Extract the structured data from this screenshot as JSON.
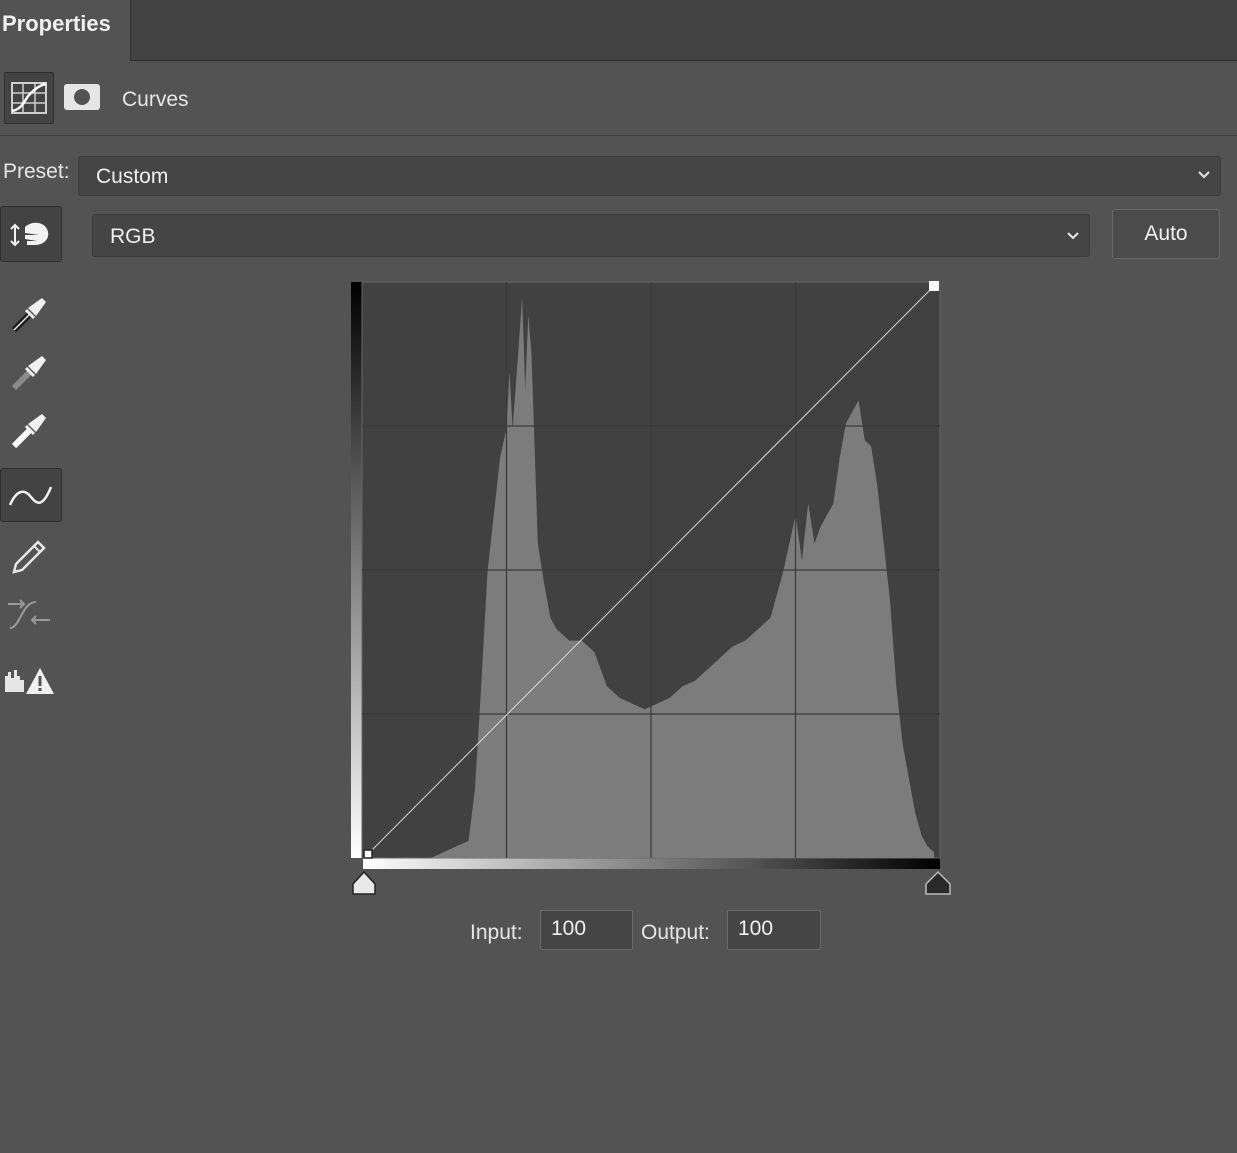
{
  "panel": {
    "tab_title": "Properties",
    "adjustment_title": "Curves"
  },
  "preset": {
    "label": "Preset:",
    "value": "Custom"
  },
  "channel": {
    "value": "RGB"
  },
  "buttons": {
    "auto_label": "Auto"
  },
  "tools": [
    {
      "name": "on-image-adjust-icon",
      "selected": true
    },
    {
      "name": "black-point-eyedropper-icon"
    },
    {
      "name": "gray-point-eyedropper-icon"
    },
    {
      "name": "white-point-eyedropper-icon"
    },
    {
      "name": "edit-points-curve-icon",
      "selected": true
    },
    {
      "name": "pencil-draw-curve-icon"
    },
    {
      "name": "smooth-curve-icon"
    },
    {
      "name": "clipping-warning-icon"
    }
  ],
  "curve": {
    "points": [
      [
        0,
        0
      ],
      [
        255,
        255
      ]
    ],
    "histogram_note_colors": {
      "histogram": "#7c7c7c",
      "plot_bg": "#414141",
      "curve_line": "#d8d8d8"
    }
  },
  "io": {
    "input_label": "Input:",
    "input_value": "100",
    "output_label": "Output:",
    "output_value": "100"
  }
}
